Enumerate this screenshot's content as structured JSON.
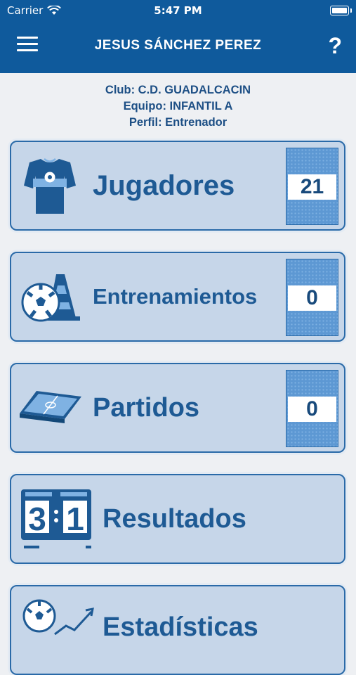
{
  "status_bar": {
    "carrier": "Carrier",
    "time": "5:47 PM"
  },
  "header": {
    "title": "JESUS SÁNCHEZ PEREZ",
    "help_label": "?"
  },
  "info": {
    "club": "Club: C.D. GUADALCACIN",
    "equipo": "Equipo: INFANTIL A",
    "perfil": "Perfil: Entrenador"
  },
  "menu": [
    {
      "label": "Jugadores",
      "count": "21",
      "icon": "jersey-icon"
    },
    {
      "label": "Entrenamientos",
      "count": "0",
      "icon": "training-icon"
    },
    {
      "label": "Partidos",
      "count": "0",
      "icon": "pitch-icon"
    },
    {
      "label": "Resultados",
      "icon": "scoreboard-icon",
      "score_home": "3",
      "score_away": "1"
    },
    {
      "label": "Estadísticas",
      "icon": "stats-icon"
    }
  ],
  "colors": {
    "primary": "#0f5a9c",
    "card_bg": "#c6d6e9",
    "text": "#1e5a94"
  }
}
